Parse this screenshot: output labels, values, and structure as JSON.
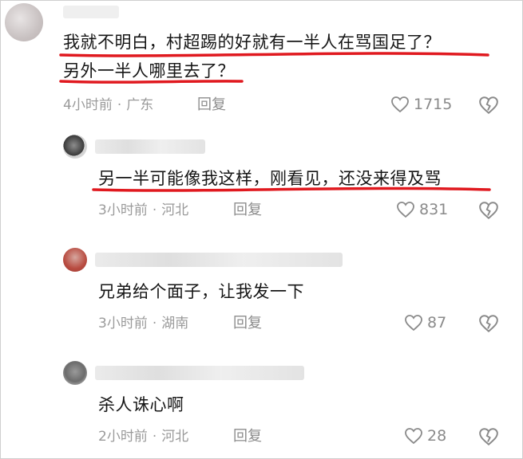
{
  "comments": [
    {
      "lines": [
        "我就不明白，村超踢的好就有一半人在骂国足了？",
        "另外一半人哪里去了？"
      ],
      "time": "4小时前",
      "location": "广东",
      "reply_label": "回复",
      "likes": "1715"
    },
    {
      "lines": [
        "另一半可能像我这样，刚看见，还没来得及骂"
      ],
      "time": "3小时前",
      "location": "河北",
      "reply_label": "回复",
      "likes": "831"
    },
    {
      "lines": [
        "兄弟给个面子，让我发一下"
      ],
      "time": "3小时前",
      "location": "湖南",
      "reply_label": "回复",
      "likes": "87"
    },
    {
      "lines": [
        "杀人诛心啊"
      ],
      "time": "2小时前",
      "location": "河北",
      "reply_label": "回复",
      "likes": "28"
    }
  ],
  "meta_separator": "·",
  "colors": {
    "underline": "#e0191f",
    "text": "#161616",
    "meta": "#9a9a9a"
  },
  "icons": {
    "like": "heart-outline-icon",
    "dislike": "broken-heart-icon"
  }
}
